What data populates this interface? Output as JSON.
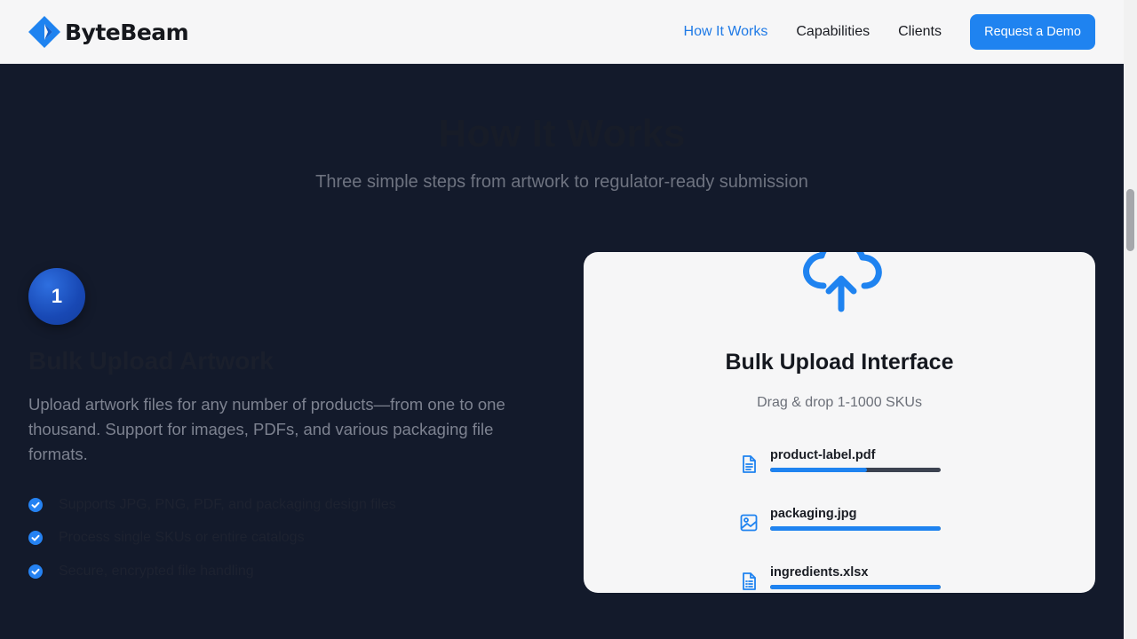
{
  "brand": {
    "name": "ByteBeam"
  },
  "nav": {
    "items": [
      {
        "label": "How It Works",
        "active": true
      },
      {
        "label": "Capabilities",
        "active": false
      },
      {
        "label": "Clients",
        "active": false
      }
    ],
    "cta_label": "Request a Demo"
  },
  "section": {
    "title": "How It Works",
    "subtitle": "Three simple steps from artwork to regulator-ready submission"
  },
  "step": {
    "number": "1",
    "title": "Bulk Upload Artwork",
    "description": "Upload artwork files for any number of products—from one to one thousand. Support for images, PDFs, and various packaging file formats.",
    "features": [
      "Supports JPG, PNG, PDF, and packaging design files",
      "Process single SKUs or entire catalogs",
      "Secure, encrypted file handling"
    ]
  },
  "card": {
    "icon": "cloud-upload-icon",
    "title": "Bulk Upload Interface",
    "subtitle": "Drag & drop 1-1000 SKUs",
    "files": [
      {
        "name": "product-label.pdf",
        "icon": "document-icon",
        "progress": 0.57
      },
      {
        "name": "packaging.jpg",
        "icon": "image-icon",
        "progress": 1.0
      },
      {
        "name": "ingredients.xlsx",
        "icon": "spreadsheet-icon",
        "progress": 1.0
      }
    ]
  },
  "colors": {
    "accent": "#1f83f0",
    "background": "#131a2b",
    "header": "#f6f6f7",
    "progress_track": "#3c4250"
  }
}
